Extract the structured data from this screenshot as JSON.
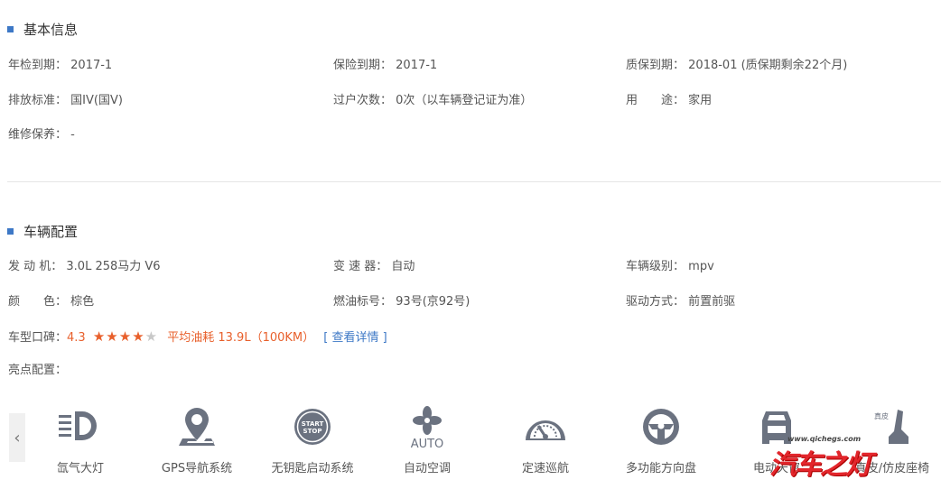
{
  "basic": {
    "title": "基本信息",
    "inspection": {
      "label": "年检到期：",
      "value": "2017-1"
    },
    "insurance": {
      "label": "保险到期：",
      "value": "2017-1"
    },
    "warranty": {
      "label": "质保到期：",
      "value": "2018-01 (质保期剩余22个月)"
    },
    "emission": {
      "label": "排放标准：",
      "value": "国IV(国V)"
    },
    "transfers": {
      "label": "过户次数：",
      "value": "0次（以车辆登记证为准）"
    },
    "usage": {
      "label": "用　　途：",
      "value": "家用"
    },
    "maintenance": {
      "label": "维修保养：",
      "value": "-"
    }
  },
  "config": {
    "title": "车辆配置",
    "engine": {
      "label": "发 动 机：",
      "value": "3.0L 258马力 V6"
    },
    "gearbox": {
      "label": "变 速 器：",
      "value": "自动"
    },
    "level": {
      "label": "车辆级别：",
      "value": "mpv"
    },
    "color": {
      "label": "颜　　色：",
      "value": "棕色"
    },
    "fuel": {
      "label": "燃油标号：",
      "value": "93号(京92号)"
    },
    "drive": {
      "label": "驱动方式：",
      "value": "前置前驱"
    },
    "reputation": {
      "label": "车型口碑：",
      "score": "4.3",
      "stars": 4,
      "stars_max": 5,
      "fuel_label": "平均油耗 13.9L（100KM）",
      "detail_link": "[ 查看详情 ]"
    },
    "highlights_label": "亮点配置："
  },
  "features": [
    {
      "icon": "xenon-headlight-icon",
      "label": "氙气大灯"
    },
    {
      "icon": "gps-navigation-icon",
      "label": "GPS导航系统"
    },
    {
      "icon": "start-stop-button-icon",
      "label": "无钥匙启动系统",
      "icon_text": "START STOP"
    },
    {
      "icon": "auto-climate-fan-icon",
      "label": "自动空调",
      "icon_text": "AUTO"
    },
    {
      "icon": "cruise-control-icon",
      "label": "定速巡航"
    },
    {
      "icon": "multifunction-steering-wheel-icon",
      "label": "多功能方向盘"
    },
    {
      "icon": "power-sunroof-icon",
      "label": "电动天窗"
    },
    {
      "icon": "leather-seat-icon",
      "label": "真皮/仿皮座椅",
      "icon_text": "真皮"
    }
  ],
  "watermark": {
    "url": "www.qichegs.com",
    "text": "汽车之灯"
  },
  "colors": {
    "accent": "#3d78c6",
    "highlight": "#e8602c",
    "icon": "#6b7280"
  }
}
